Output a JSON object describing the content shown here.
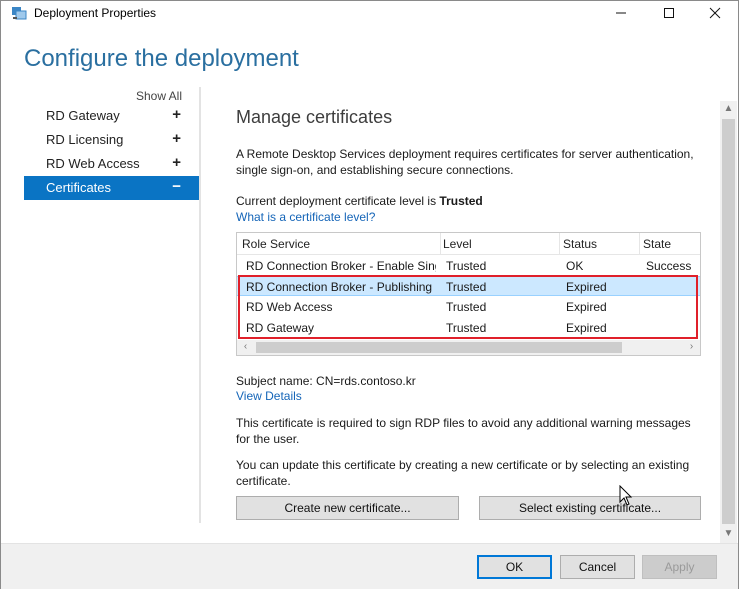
{
  "window": {
    "title": "Deployment Properties",
    "controls": {
      "minimize": "—",
      "maximize": "☐",
      "close": "✕"
    }
  },
  "heading": "Configure the deployment",
  "nav": {
    "show_all": "Show All",
    "items": [
      {
        "label": "RD Gateway",
        "indicator": "+"
      },
      {
        "label": "RD Licensing",
        "indicator": "+"
      },
      {
        "label": "RD Web Access",
        "indicator": "+"
      },
      {
        "label": "Certificates",
        "indicator": "−",
        "selected": true
      }
    ]
  },
  "content": {
    "title": "Manage certificates",
    "description": "A Remote Desktop Services deployment requires certificates for server authentication, single sign-on, and establishing secure connections.",
    "level_prefix": "Current deployment certificate level is ",
    "level_value": "Trusted",
    "level_link": "What is a certificate level?",
    "table": {
      "columns": [
        "Role Service",
        "Level",
        "Status",
        "State"
      ],
      "rows": [
        {
          "role": "RD Connection Broker - Enable Sing",
          "level": "Trusted",
          "status": "OK",
          "state": "Success"
        },
        {
          "role": "RD Connection Broker - Publishing",
          "level": "Trusted",
          "status": "Expired",
          "state": ""
        },
        {
          "role": "RD Web Access",
          "level": "Trusted",
          "status": "Expired",
          "state": ""
        },
        {
          "role": "RD Gateway",
          "level": "Trusted",
          "status": "Expired",
          "state": ""
        }
      ]
    },
    "subject": "Subject name: CN=rds.contoso.kr",
    "view_details": "View Details",
    "para1": "This certificate is required to sign RDP files to avoid any additional warning messages for the user.",
    "para2": "You can update this certificate by creating a new certificate or by selecting an existing certificate.",
    "create_button": "Create new certificate...",
    "select_button": "Select existing certificate..."
  },
  "footer": {
    "ok": "OK",
    "cancel": "Cancel",
    "apply": "Apply"
  },
  "colors": {
    "accent": "#0a74c4",
    "heading": "#2a6fa0",
    "link": "#1565b8",
    "highlight_border": "#e0202a",
    "selected_row": "#cce8ff"
  }
}
